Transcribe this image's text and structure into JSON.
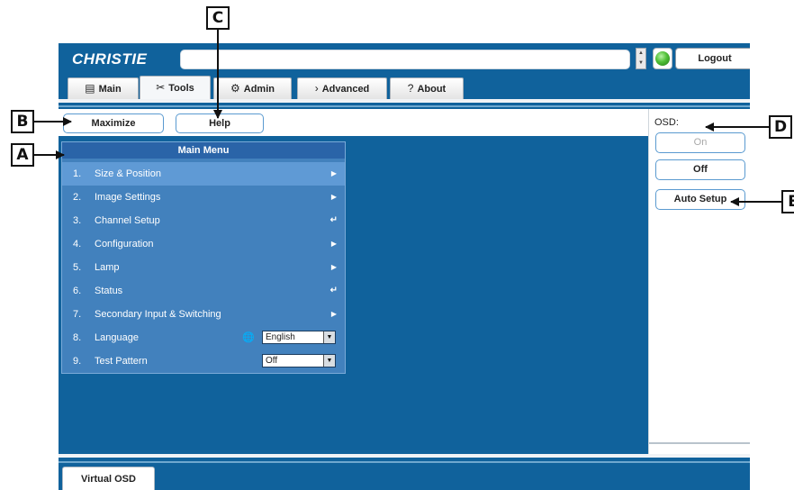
{
  "header": {
    "logo": "CHRISTIE",
    "logout_label": "Logout"
  },
  "tabs": [
    {
      "label": "Main",
      "icon": "monitor-icon",
      "glyph": "▤"
    },
    {
      "label": "Tools",
      "icon": "tools-icon",
      "glyph": "✂"
    },
    {
      "label": "Admin",
      "icon": "admin-icon",
      "glyph": "⚙"
    },
    {
      "label": "Advanced",
      "icon": "advanced-icon",
      "glyph": "›"
    },
    {
      "label": "About",
      "icon": "question-icon",
      "glyph": "?"
    }
  ],
  "toolbar": {
    "maximize_label": "Maximize",
    "help_label": "Help"
  },
  "menu": {
    "title": "Main Menu",
    "items": [
      {
        "num": "1.",
        "label": "Size & Position",
        "marker": "▶"
      },
      {
        "num": "2.",
        "label": "Image Settings",
        "marker": "▶"
      },
      {
        "num": "3.",
        "label": "Channel Setup",
        "marker": "↵"
      },
      {
        "num": "4.",
        "label": "Configuration",
        "marker": "▶"
      },
      {
        "num": "5.",
        "label": "Lamp",
        "marker": "▶"
      },
      {
        "num": "6.",
        "label": "Status",
        "marker": "↵"
      },
      {
        "num": "7.",
        "label": "Secondary Input & Switching",
        "marker": "▶"
      },
      {
        "num": "8.",
        "label": "Language",
        "value": "English"
      },
      {
        "num": "9.",
        "label": "Test Pattern",
        "value": "Off"
      }
    ]
  },
  "osd": {
    "label": "OSD:",
    "on_label": "On",
    "off_label": "Off",
    "auto_setup_label": "Auto Setup"
  },
  "bottom": {
    "virtual_osd_label": "Virtual OSD"
  },
  "callouts": {
    "a": "A",
    "b": "B",
    "c": "C",
    "d": "D",
    "e": "E"
  }
}
